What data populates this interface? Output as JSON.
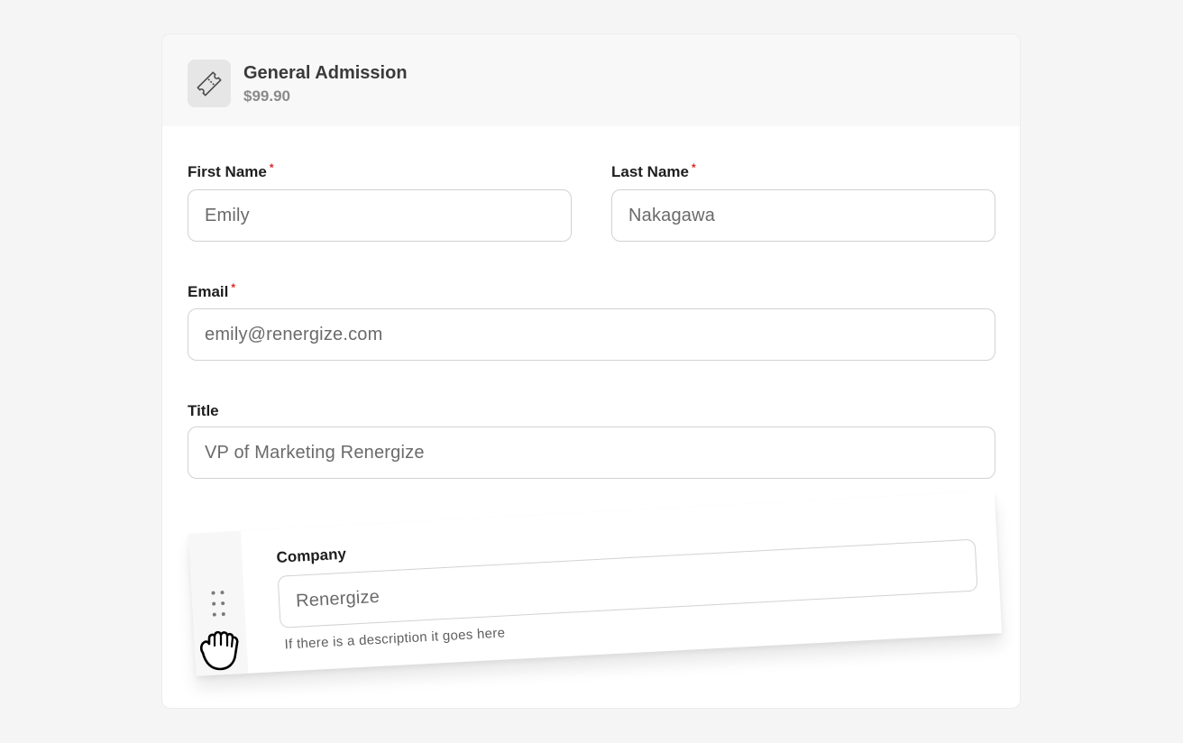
{
  "ticket": {
    "icon": "ticket-icon",
    "title": "General Admission",
    "price": "$99.90"
  },
  "form": {
    "first_name": {
      "label": "First Name",
      "required_mark": "*",
      "value": "Emily"
    },
    "last_name": {
      "label": "Last Name",
      "required_mark": "*",
      "value": "Nakagawa"
    },
    "email": {
      "label": "Email",
      "required_mark": "*",
      "value": "emily@renergize.com"
    },
    "title": {
      "label": "Title",
      "value": "VP of Marketing Renergize"
    }
  },
  "dragged_field": {
    "handle_icon": "drag-handle-icon",
    "label": "Company",
    "value": "Renergize",
    "description": "If there is a description it goes here"
  },
  "cursor": {
    "icon": "grab-hand-cursor-icon"
  },
  "colors": {
    "page_background": "#f5f5f5",
    "header_background": "#f8f8f8",
    "required": "#e02424",
    "input_border": "#d2d2d2"
  }
}
